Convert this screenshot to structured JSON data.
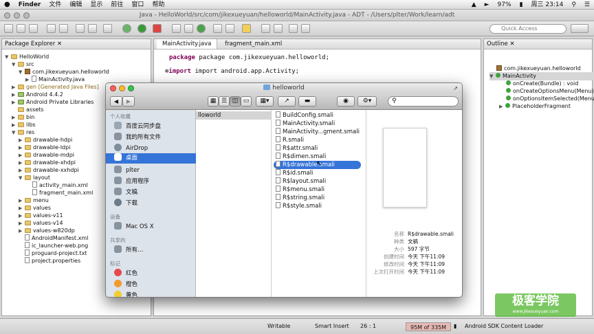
{
  "menubar": {
    "app": "Finder",
    "items": [
      "文件",
      "编辑",
      "显示",
      "前往",
      "窗口",
      "帮助"
    ],
    "battery": "97%",
    "clock": "周三 23:14"
  },
  "window": {
    "title": "Java - HelloWorld/src/com/jikexueyuan/helloworld/MainActivity.java - ADT - /Users/plter/Work/learn/adt"
  },
  "toolbar": {
    "quick_access": "Quick Access"
  },
  "package_explorer": {
    "tab": "Package Explorer",
    "items": [
      "HelloWorld",
      "src",
      "com.jikexueyuan.helloworld",
      "MainActivity.java",
      "gen [Generated Java Files]",
      "Android 4.4.2",
      "Android Private Libraries",
      "assets",
      "bin",
      "libs",
      "res",
      "drawable-hdpi",
      "drawable-ldpi",
      "drawable-mdpi",
      "drawable-xhdpi",
      "drawable-xxhdpi",
      "layout",
      "activity_main.xml",
      "fragment_main.xml",
      "menu",
      "values",
      "values-v11",
      "values-v14",
      "values-w820dp",
      "AndroidManifest.xml",
      "ic_launcher-web.png",
      "proguard-project.txt",
      "project.properties"
    ]
  },
  "editor": {
    "tabs": [
      "MainActivity.java",
      "fragment_main.xml"
    ],
    "lines": [
      "package com.jikexueyuan.helloworld;",
      "import android.app.Activity;"
    ]
  },
  "outline": {
    "tab": "Outline",
    "items": [
      "com.jikexueyuan.helloworld",
      "MainActivity",
      "onCreate(Bundle) : void",
      "onCreateOptionsMenu(Menu)",
      "onOptionsItemSelected(Menu",
      "PlaceholderFragment"
    ]
  },
  "finder": {
    "title": "helloworld",
    "favorites_header": "个人收藏",
    "favorites": [
      "百度云同步盘",
      "我的所有文件",
      "AirDrop",
      "桌面",
      "plter",
      "应用程序",
      "文稿",
      "下载"
    ],
    "devices_header": "设备",
    "devices": [
      "Mac OS X"
    ],
    "shared_header": "共享的",
    "shared": [
      "所有…"
    ],
    "tags_header": "标记",
    "tags": [
      "红色",
      "橙色",
      "黄色"
    ],
    "column1": "lloworld",
    "files": [
      "BuildConfig.smali",
      "MainActivity.smali",
      "MainActivity...gment.smali",
      "R.smali",
      "R$attr.smali",
      "R$dimen.smali",
      "R$drawable.smali",
      "R$id.smali",
      "R$layout.smali",
      "R$menu.smali",
      "R$string.smali",
      "R$style.smali"
    ],
    "selected_file": "R$drawable.smali",
    "info_labels": [
      "名称",
      "种类",
      "大小",
      "创建时间",
      "修改时间",
      "上次打开时间"
    ],
    "info_values": [
      "R$drawable.smali",
      "文稿",
      "597 字节",
      "今天 下午11:09",
      "今天 下午11:09",
      "今天 下午11:09"
    ]
  },
  "statusbar": {
    "mode": "Writable",
    "insert": "Smart Insert",
    "position": "26 : 1",
    "memory": "95M of 335M",
    "loader": "Android SDK Content Loader"
  },
  "watermark": {
    "name": "极客学院",
    "url": "www.jikexueyuan.com"
  },
  "colors": {
    "selection": "#3574d8",
    "finder_sidebar": "#dde3ea",
    "keyword": "#7f0055"
  }
}
